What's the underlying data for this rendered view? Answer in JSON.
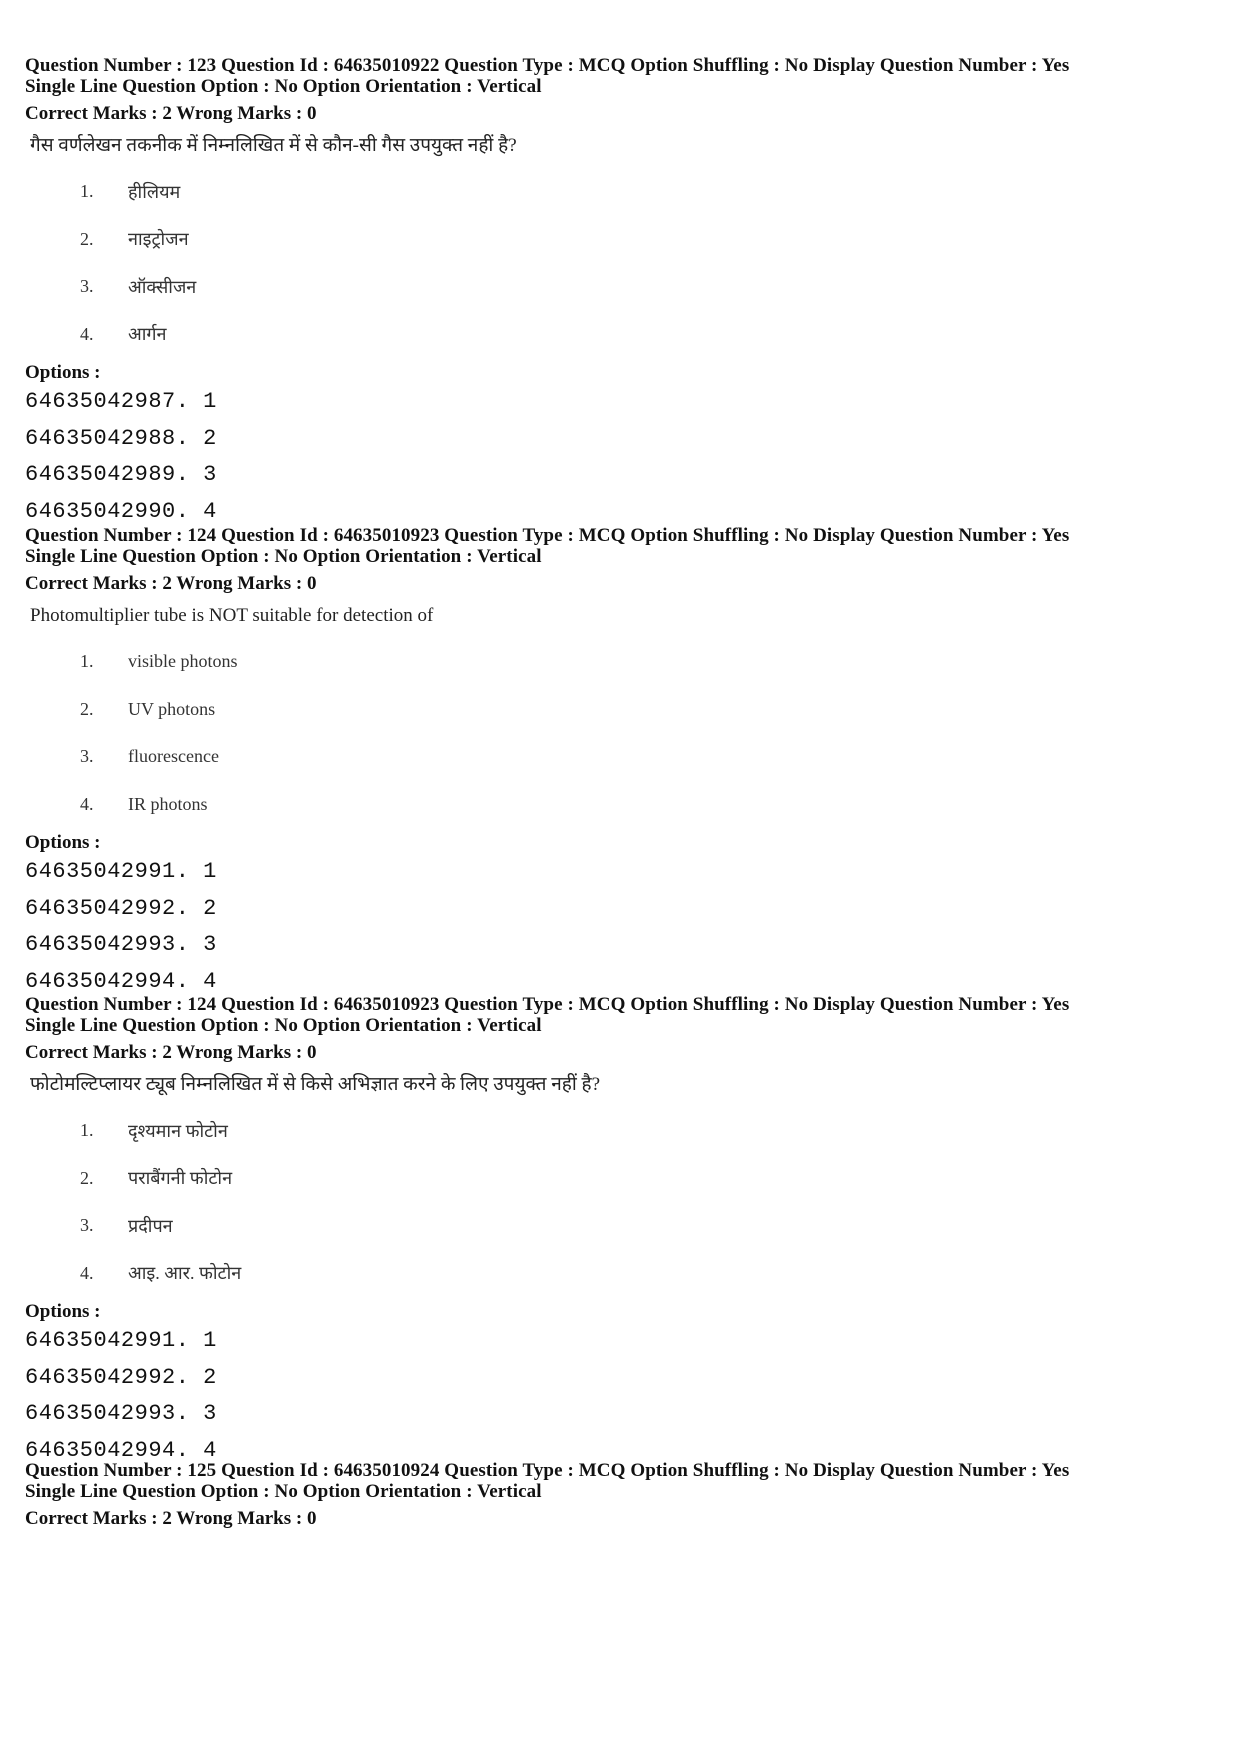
{
  "questions": [
    {
      "meta_line1": "Question Number : 123  Question Id : 64635010922  Question Type : MCQ  Option Shuffling : No  Display Question Number : Yes",
      "meta_line2": "Single Line Question Option : No  Option Orientation : Vertical",
      "marks": "Correct Marks : 2  Wrong Marks : 0",
      "text": "गैस वर्णलेखन तकनीक में निम्नलिखित में से कौन-सी गैस उपयुक्त नहीं है?",
      "choices": [
        {
          "num": "1.",
          "label": "हीलियम"
        },
        {
          "num": "2.",
          "label": "नाइट्रोजन"
        },
        {
          "num": "3.",
          "label": "ऑक्सीजन"
        },
        {
          "num": "4.",
          "label": "आर्गन"
        }
      ],
      "options_label": "Options :",
      "option_ids": [
        "64635042987. 1",
        "64635042988. 2",
        "64635042989. 3",
        "64635042990. 4"
      ]
    },
    {
      "meta_line1": "Question Number : 124  Question Id : 64635010923  Question Type : MCQ  Option Shuffling : No  Display Question Number : Yes",
      "meta_line2": "Single Line Question Option : No  Option Orientation : Vertical",
      "marks": "Correct Marks : 2  Wrong Marks : 0",
      "text": "Photomultiplier tube is NOT suitable for detection of",
      "choices": [
        {
          "num": "1.",
          "label": "visible photons"
        },
        {
          "num": "2.",
          "label": "UV photons"
        },
        {
          "num": "3.",
          "label": "fluorescence"
        },
        {
          "num": "4.",
          "label": "IR photons"
        }
      ],
      "options_label": "Options :",
      "option_ids": [
        "64635042991. 1",
        "64635042992. 2",
        "64635042993. 3",
        "64635042994. 4"
      ]
    },
    {
      "meta_line1": "Question Number : 124  Question Id : 64635010923  Question Type : MCQ  Option Shuffling : No  Display Question Number : Yes",
      "meta_line2": "Single Line Question Option : No  Option Orientation : Vertical",
      "marks": "Correct Marks : 2  Wrong Marks : 0",
      "text": "फोटोमल्टिप्लायर ट्यूब निम्नलिखित में से किसे अभिज्ञात करने के लिए उपयुक्त नहीं है?",
      "choices": [
        {
          "num": "1.",
          "label": "दृश्यमान फोटोन"
        },
        {
          "num": "2.",
          "label": "पराबैंगनी फोटोन"
        },
        {
          "num": "3.",
          "label": "प्रदीपन"
        },
        {
          "num": "4.",
          "label": "आइ. आर. फोटोन"
        }
      ],
      "options_label": "Options :",
      "option_ids": [
        "64635042991. 1",
        "64635042992. 2",
        "64635042993. 3",
        "64635042994. 4"
      ]
    },
    {
      "meta_line1": "Question Number : 125  Question Id : 64635010924  Question Type : MCQ  Option Shuffling : No  Display Question Number : Yes",
      "meta_line2": "Single Line Question Option : No  Option Orientation : Vertical",
      "marks": "Correct Marks : 2  Wrong Marks : 0"
    }
  ]
}
